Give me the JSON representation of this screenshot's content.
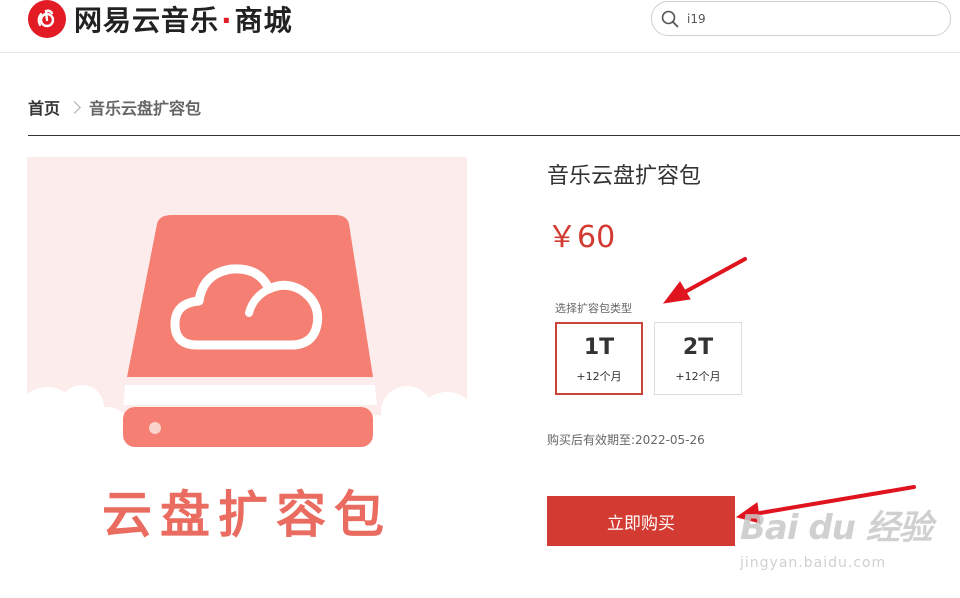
{
  "header": {
    "logo_text": "网易云音乐",
    "logo_suffix": "商城",
    "search_value": "i19"
  },
  "breadcrumb": {
    "home": "首页",
    "current": "音乐云盘扩容包"
  },
  "product": {
    "title": "音乐云盘扩容包",
    "price": "￥60",
    "image_caption": "云盘扩容包",
    "option_label": "选择扩容包类型",
    "options": [
      {
        "size": "1T",
        "duration": "+12个月",
        "selected": true
      },
      {
        "size": "2T",
        "duration": "+12个月",
        "selected": false
      }
    ],
    "validity": "购买后有效期至:2022-05-26",
    "buy_label": "立即购买"
  },
  "watermark": {
    "main": "Bai du 经验",
    "url": "jingyan.baidu.com"
  },
  "colors": {
    "brand": "#e21b25",
    "accent": "#d33a31",
    "image_bg": "#fdecec",
    "disk": "#f47f72"
  }
}
